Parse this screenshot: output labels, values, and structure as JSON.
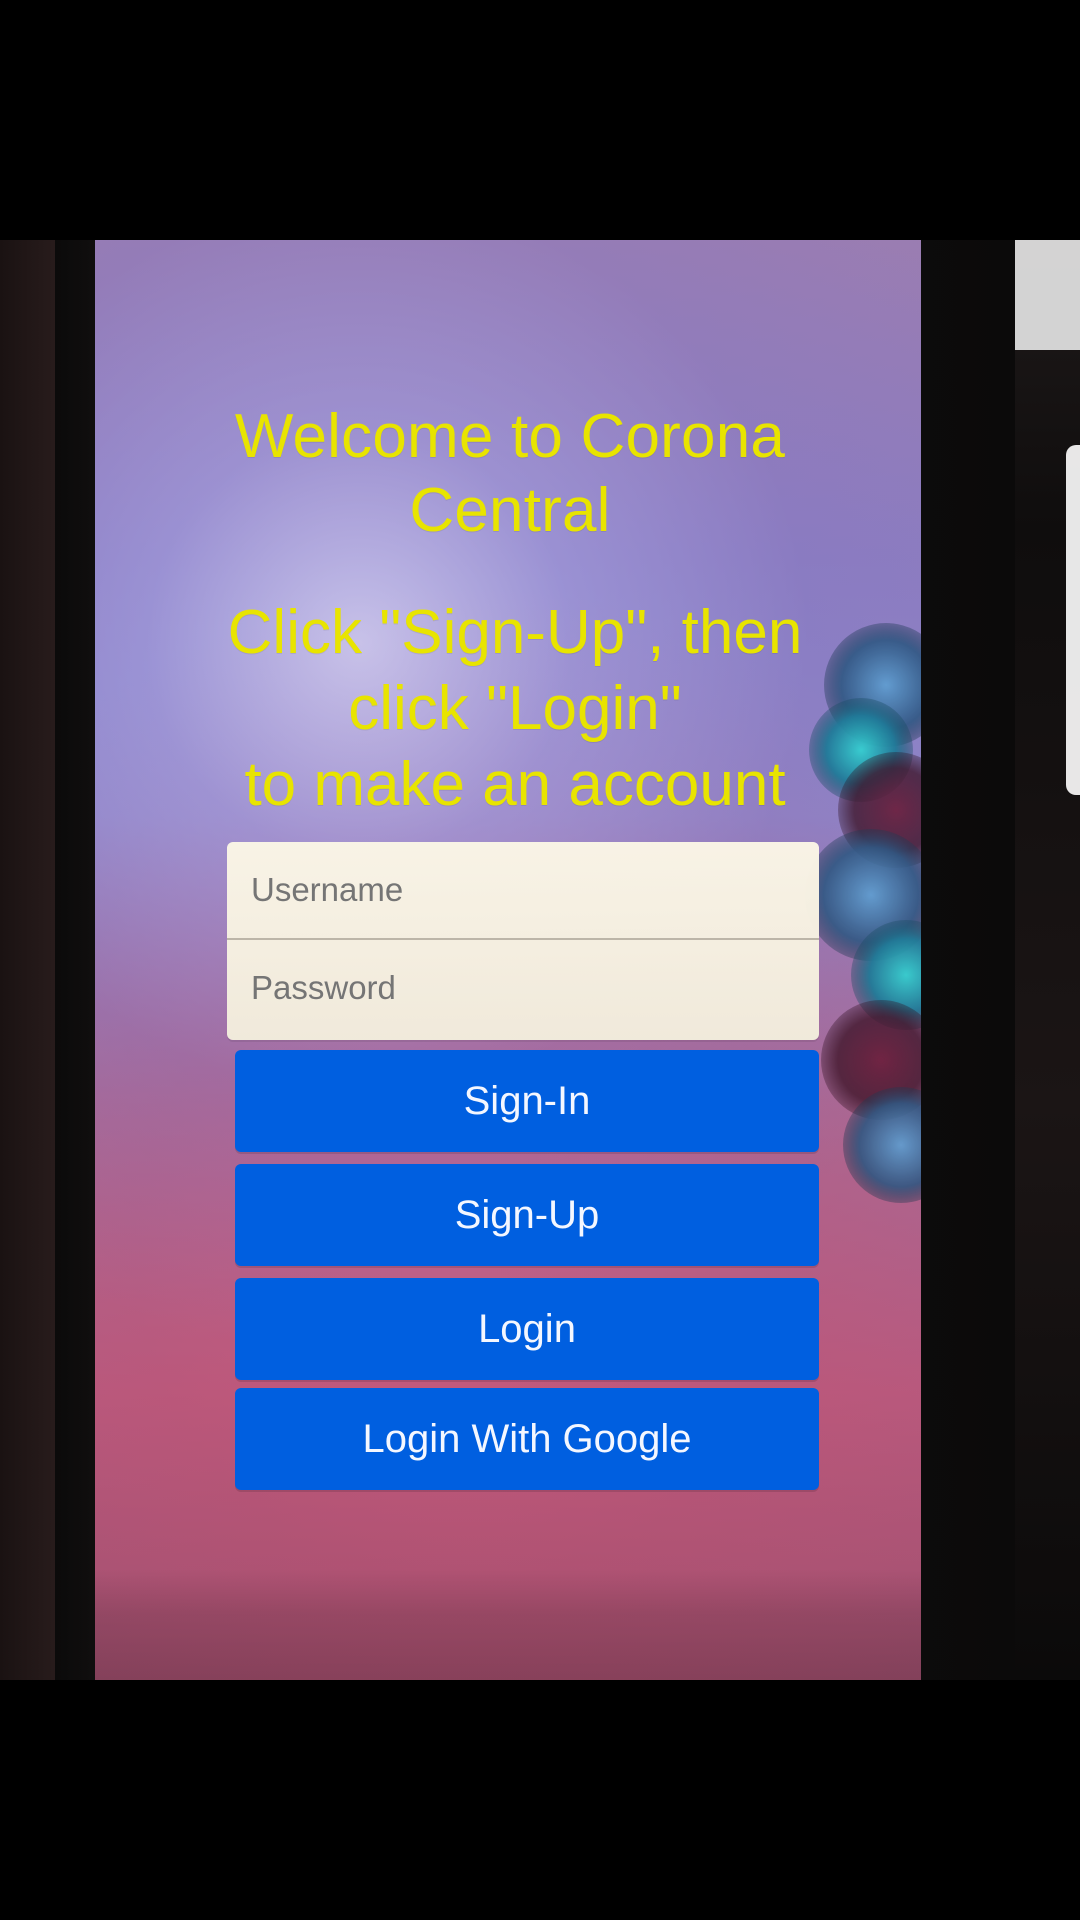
{
  "screen": {
    "title": "Welcome to Corona Central",
    "subtitle": "Click \"Sign-Up\", then\nclick \"Login\"\nto make an account"
  },
  "form": {
    "username_placeholder": "Username",
    "password_placeholder": "Password"
  },
  "buttons": {
    "sign_in": "Sign-In",
    "sign_up": "Sign-Up",
    "login": "Login",
    "login_google": "Login With Google"
  },
  "colors": {
    "title_text": "#e8e400",
    "primary_button": "#005fe0",
    "input_background": "#f4eedb"
  }
}
